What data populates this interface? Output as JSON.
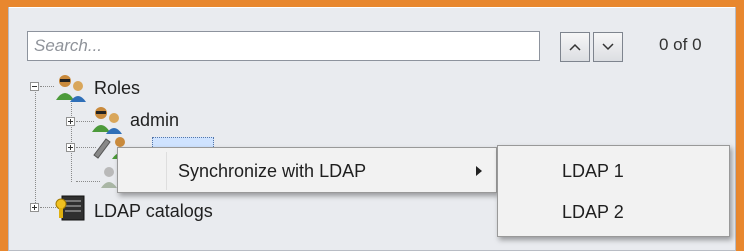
{
  "search": {
    "placeholder": "Search...",
    "value": ""
  },
  "navigation": {
    "prev_icon": "chevron-up-icon",
    "next_icon": "chevron-down-icon",
    "counter": "0 of 0"
  },
  "tree": {
    "roles_label": "Roles",
    "admin_label": "admin",
    "ldap_catalogs_label": "LDAP catalogs"
  },
  "context_menu": {
    "item": "Synchronize with LDAP"
  },
  "submenu": {
    "items": [
      "LDAP 1",
      "LDAP 2"
    ]
  },
  "colors": {
    "background": "#e8872e",
    "panel": "#e9ebef",
    "menu": "#f2f2f2",
    "selection": "#cfe3ff"
  }
}
